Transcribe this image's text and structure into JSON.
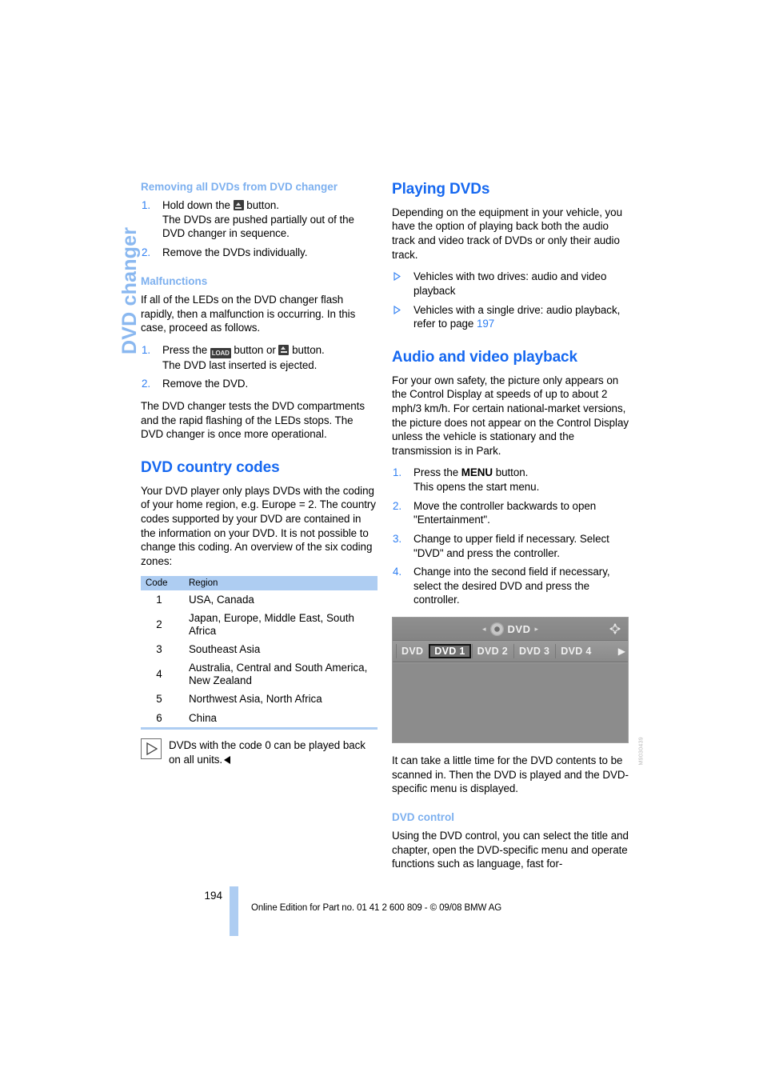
{
  "chapter_tab": {
    "label": "DVD changer"
  },
  "left_column": {
    "removing": {
      "heading": "Removing all DVDs from DVD changer",
      "steps": [
        {
          "num": "1.",
          "pre": "Hold down the ",
          "icon": "eject-button-icon",
          "post": " button.",
          "continuation": "The DVDs are pushed partially out of the DVD changer in sequence."
        },
        {
          "num": "2.",
          "pre": "Remove the DVDs individually.",
          "post": "",
          "continuation": ""
        }
      ]
    },
    "malfunctions": {
      "heading": "Malfunctions",
      "intro": "If all of the LEDs on the DVD changer flash rapidly, then a malfunction is occurring. In this case, proceed as follows.",
      "steps": [
        {
          "num": "1.",
          "pre": "Press the ",
          "icon_load": "LOAD",
          "mid": " button or ",
          "icon_eject": "eject-button-icon",
          "post": " button.",
          "continuation": "The DVD last inserted is ejected."
        },
        {
          "num": "2.",
          "pre": "Remove the DVD.",
          "post": "",
          "continuation": ""
        }
      ],
      "outro": "The DVD changer tests the DVD compartments and the rapid flashing of the LEDs stops. The DVD changer is once more operational."
    },
    "country_codes": {
      "heading": "DVD country codes",
      "intro": "Your DVD player only plays DVDs with the coding of your home region, e.g. Europe = 2. The country codes supported by your DVD are contained in the information on your DVD. It is not possible to change this coding. An overview of the six coding zones:",
      "table": {
        "headers": [
          "Code",
          "Region"
        ],
        "rows": [
          {
            "code": "1",
            "region": "USA, Canada"
          },
          {
            "code": "2",
            "region": "Japan, Europe, Middle East, South Africa"
          },
          {
            "code": "3",
            "region": "Southeast Asia"
          },
          {
            "code": "4",
            "region": "Australia, Central and South America, New Zealand"
          },
          {
            "code": "5",
            "region": "Northwest Asia, North Africa"
          },
          {
            "code": "6",
            "region": "China"
          }
        ]
      },
      "note": "DVDs with the code 0 can be played back on all units."
    }
  },
  "right_column": {
    "playing": {
      "heading": "Playing DVDs",
      "intro": "Depending on the equipment in your vehicle, you have the option of playing back both the audio track and video track of DVDs or only their audio track.",
      "bullets": [
        {
          "text": "Vehicles with two drives: audio and video playback",
          "ref": ""
        },
        {
          "text": "Vehicles with a single drive: audio playback, refer to page ",
          "ref": "197"
        }
      ]
    },
    "audio_video": {
      "heading": "Audio and video playback",
      "intro": "For your own safety, the picture only appears on the Control Display at speeds of up to about 2 mph/3 km/h. For certain national-market versions, the picture does not appear on the Control Display unless the vehicle is stationary and the transmission is in Park.",
      "steps": [
        {
          "num": "1.",
          "pre": "Press the ",
          "bold": "MENU",
          "post": " button.",
          "continuation": "This opens the start menu."
        },
        {
          "num": "2.",
          "pre": "Move the controller backwards to open \"Entertainment\".",
          "post": "",
          "continuation": ""
        },
        {
          "num": "3.",
          "pre": "Change to upper field if necessary. Select \"DVD\" and press the controller.",
          "post": "",
          "continuation": ""
        },
        {
          "num": "4.",
          "pre": "Change into the second field if necessary, select the desired DVD and press the controller.",
          "post": "",
          "continuation": ""
        }
      ],
      "screenshot": {
        "title": "DVD",
        "left_arrow": "◂",
        "right_arrow": "▸",
        "tabs": [
          "DVD",
          "DVD 1",
          "DVD 2",
          "DVD 3",
          "DVD 4"
        ],
        "selected_tab": "DVD 1",
        "next_arrow": "▶",
        "figure_code": "M9030439"
      },
      "after_figure": "It can take a little time for the DVD contents to be scanned in. Then the DVD is played and the DVD-specific menu is displayed."
    },
    "dvd_control": {
      "heading": "DVD control",
      "text": "Using the DVD control, you can select the title and chapter, open the DVD-specific menu and operate functions such as language, fast for-"
    }
  },
  "footer": {
    "page_number": "194",
    "legal": "Online Edition for Part no. 01 41 2 600 809 - © 09/08 BMW AG"
  },
  "colors": {
    "heading_blue": "#1668f0",
    "subheading_blue": "#7db0ef",
    "tab_blue": "#8ab8f0",
    "table_header_blue": "#aecdf2",
    "number_blue": "#2f7ff2"
  }
}
